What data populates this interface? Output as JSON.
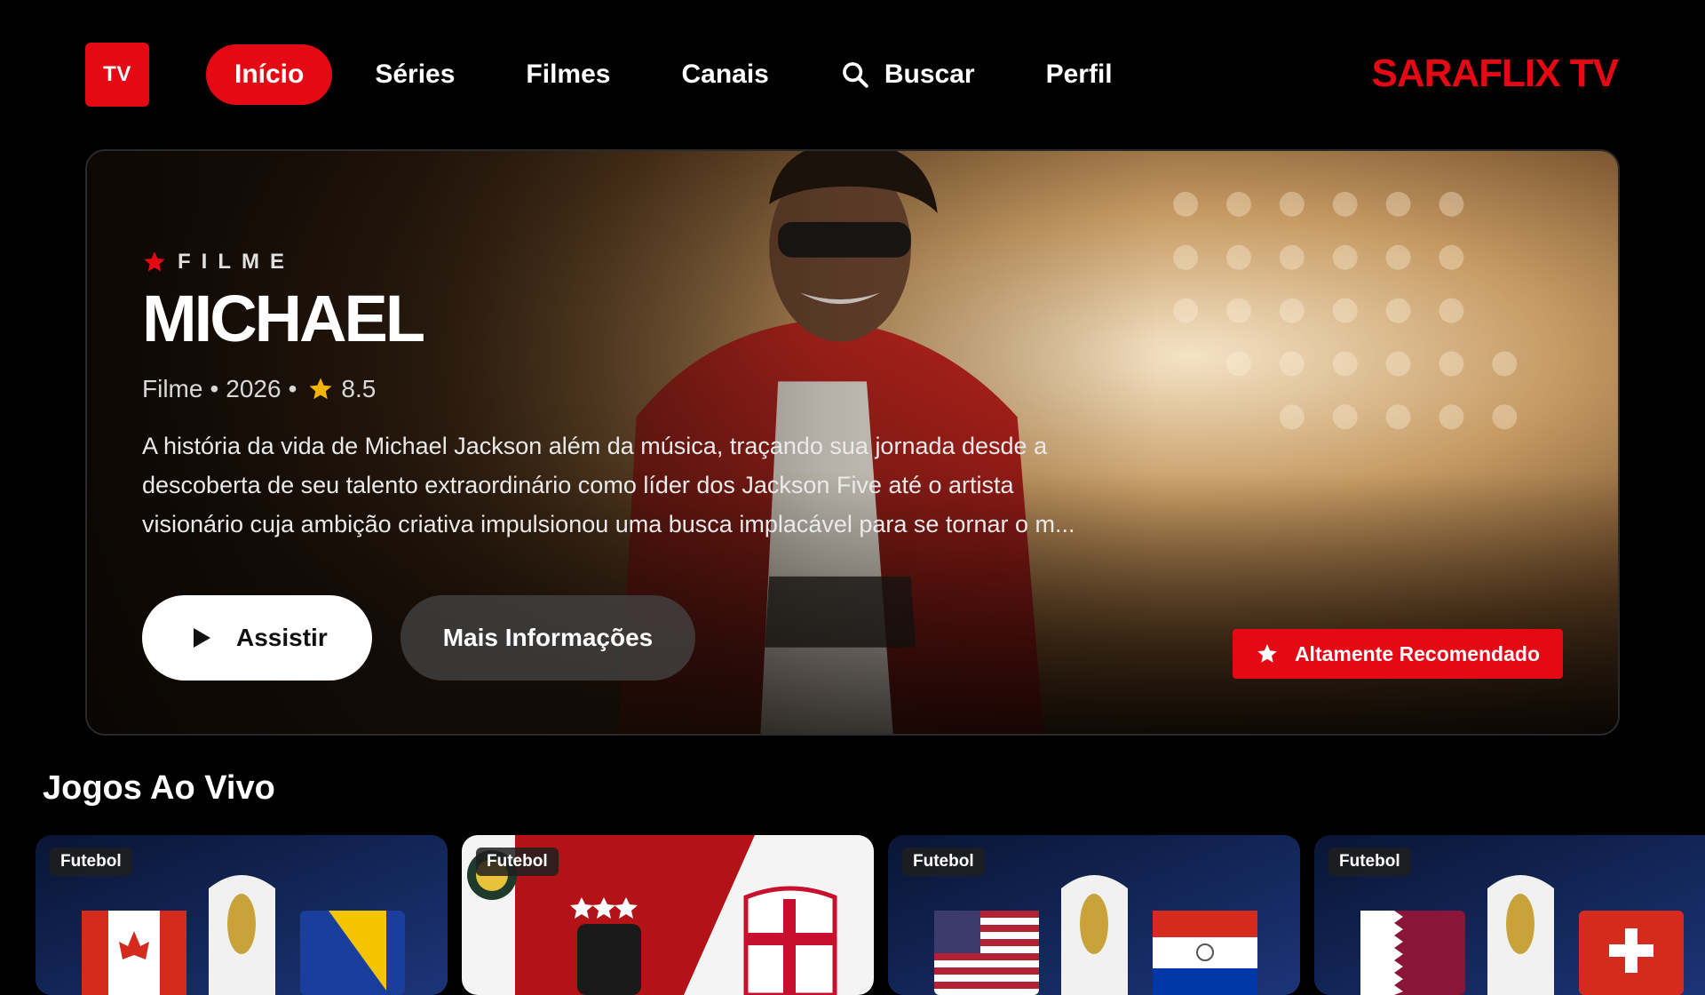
{
  "logo": {
    "label": "TV"
  },
  "nav": {
    "items": [
      {
        "label": "Início",
        "active": true
      },
      {
        "label": "Séries"
      },
      {
        "label": "Filmes"
      },
      {
        "label": "Canais"
      },
      {
        "label": "Buscar",
        "icon": "search-icon"
      },
      {
        "label": "Perfil"
      }
    ]
  },
  "brand": "SARAFLIX TV",
  "hero": {
    "kicker": "FILME",
    "title": "MICHAEL",
    "meta": {
      "type": "Filme",
      "year": "2026",
      "rating": "8.5"
    },
    "description": "A história da vida de Michael Jackson além da música, traçando sua jornada desde a descoberta de seu talento extraordinário como líder dos Jackson Five até o artista visionário cuja ambição criativa impulsionou uma busca implacável para se tornar o m...",
    "primary_button": "Assistir",
    "secondary_button": "Mais Informações",
    "badge": "Altamente Recomendado"
  },
  "section": {
    "title": "Jogos Ao Vivo",
    "cards": [
      {
        "tag": "Futebol",
        "theme": "worldcup",
        "flags": [
          "canada",
          "bosnia"
        ]
      },
      {
        "tag": "Futebol",
        "theme": "brasileirao"
      },
      {
        "tag": "Futebol",
        "theme": "worldcup",
        "flags": [
          "usa",
          "paraguay"
        ]
      },
      {
        "tag": "Futebol",
        "theme": "worldcup",
        "flags": [
          "qatar",
          "switzerland"
        ]
      }
    ]
  },
  "colors": {
    "accent": "#e50914",
    "background": "#000000"
  }
}
